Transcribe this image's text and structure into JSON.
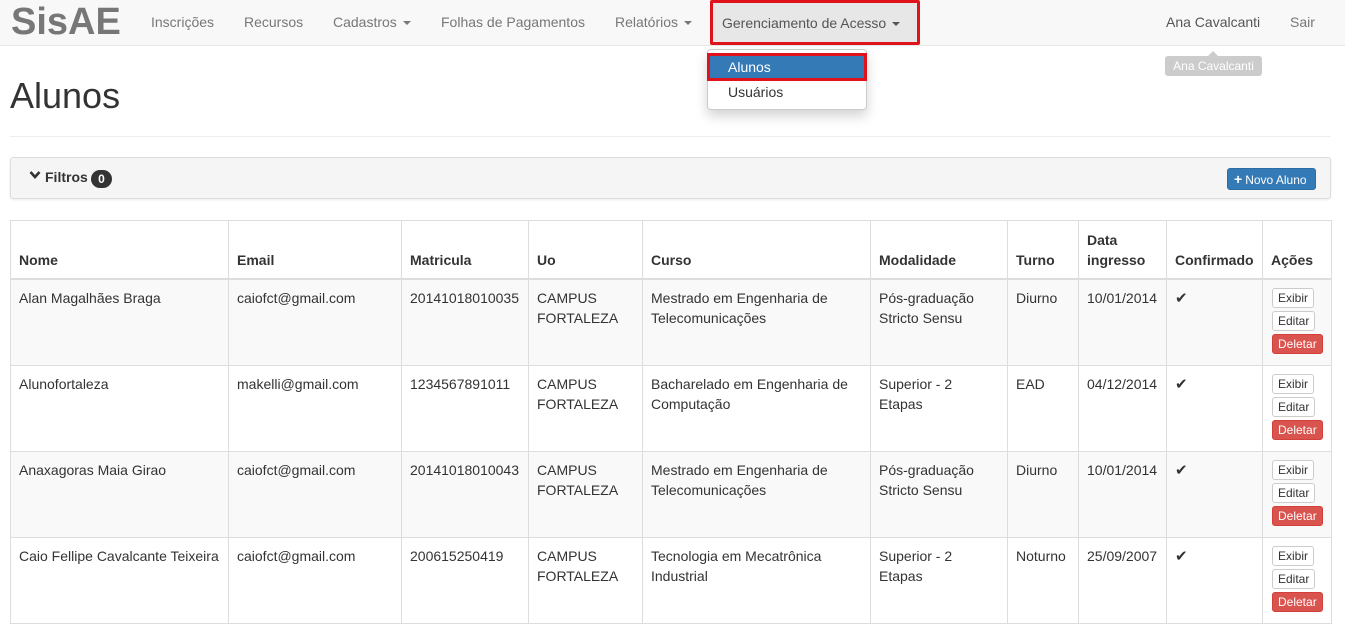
{
  "navbar": {
    "brand": "SisAE",
    "items": [
      {
        "label": "Inscrições"
      },
      {
        "label": "Recursos"
      },
      {
        "label": "Cadastros"
      },
      {
        "label": "Folhas de Pagamentos"
      },
      {
        "label": "Relatórios"
      },
      {
        "label": "Gerenciamento de Acesso"
      }
    ],
    "user": "Ana Cavalcanti",
    "logout": "Sair",
    "tooltip": "Ana Cavalcanti"
  },
  "dropdown": {
    "items": [
      {
        "label": "Alunos",
        "active": true
      },
      {
        "label": "Usuários"
      }
    ]
  },
  "page": {
    "title": "Alunos",
    "filters_label": "Filtros",
    "filters_count": "0",
    "new_button": "Novo Aluno"
  },
  "table": {
    "headers": [
      "Nome",
      "Email",
      "Matricula",
      "Uo",
      "Curso",
      "Modalidade",
      "Turno",
      "Data ingresso",
      "Confirmado",
      "Ações"
    ],
    "action_labels": {
      "show": "Exibir",
      "edit": "Editar",
      "delete": "Deletar"
    },
    "rows": [
      {
        "nome": "Alan Magalhães Braga",
        "email": "caiofct@gmail.com",
        "matricula": "20141018010035",
        "uo": "CAMPUS FORTALEZA",
        "curso": "Mestrado em Engenharia de Telecomunicações",
        "modalidade": "Pós-graduação Stricto Sensu",
        "turno": "Diurno",
        "data": "10/01/2014",
        "confirmado": "✔"
      },
      {
        "nome": "Alunofortaleza",
        "email": "makelli@gmail.com",
        "matricula": "1234567891011",
        "uo": "CAMPUS FORTALEZA",
        "curso": "Bacharelado em Engenharia de Computação",
        "modalidade": "Superior - 2 Etapas",
        "turno": "EAD",
        "data": "04/12/2014",
        "confirmado": "✔"
      },
      {
        "nome": "Anaxagoras Maia Girao",
        "email": "caiofct@gmail.com",
        "matricula": "20141018010043",
        "uo": "CAMPUS FORTALEZA",
        "curso": "Mestrado em Engenharia de Telecomunicações",
        "modalidade": "Pós-graduação Stricto Sensu",
        "turno": "Diurno",
        "data": "10/01/2014",
        "confirmado": "✔"
      },
      {
        "nome": "Caio Fellipe Cavalcante Teixeira",
        "email": "caiofct@gmail.com",
        "matricula": "200615250419",
        "uo": "CAMPUS FORTALEZA",
        "curso": "Tecnologia em Mecatrônica Industrial",
        "modalidade": "Superior - 2 Etapas",
        "turno": "Noturno",
        "data": "25/09/2007",
        "confirmado": "✔"
      }
    ]
  },
  "colors": {
    "primary": "#337ab7",
    "danger": "#d9534f",
    "highlight": "#e0131d"
  }
}
